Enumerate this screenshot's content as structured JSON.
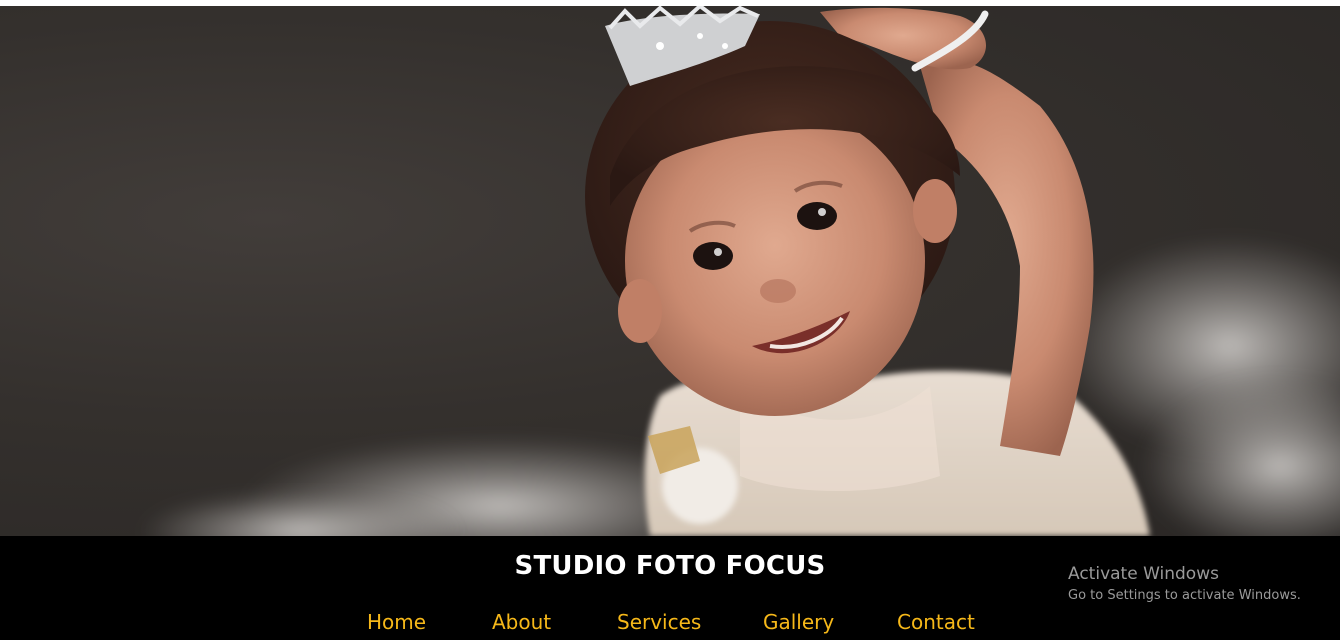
{
  "hero": {
    "image_subject": "smiling baby girl wearing a tiara and white dress"
  },
  "header": {
    "brand": "STUDIO FOTO FOCUS"
  },
  "nav": {
    "items": [
      {
        "label": "Home"
      },
      {
        "label": "About"
      },
      {
        "label": "Services"
      },
      {
        "label": "Gallery"
      },
      {
        "label": "Contact"
      }
    ]
  },
  "watermark": {
    "title": "Activate Windows",
    "subtitle": "Go to Settings to activate Windows."
  },
  "colors": {
    "nav_link": "#f6b819",
    "footer_bg": "#000000",
    "brand_text": "#ffffff"
  }
}
